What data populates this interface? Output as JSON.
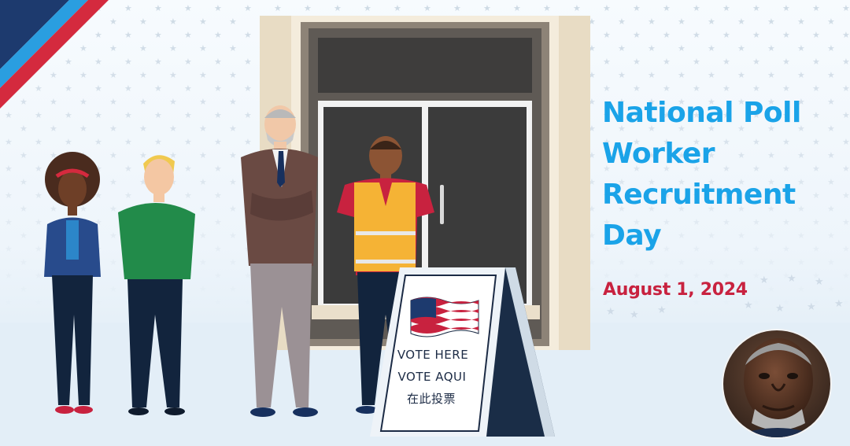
{
  "headline": {
    "line1": "National Poll",
    "line2": "Worker",
    "line3": "Recruitment",
    "line4": "Day"
  },
  "event_date": "August 1, 2024",
  "sign": {
    "line1": "VOTE HERE",
    "line2": "VOTE AQUI",
    "line3": "在此投票"
  },
  "colors": {
    "headline": "#1aa3e8",
    "date": "#c8223f",
    "stripe_navy": "#1d3a6e",
    "stripe_blue": "#2a9ee0",
    "stripe_red": "#d42a3e"
  }
}
